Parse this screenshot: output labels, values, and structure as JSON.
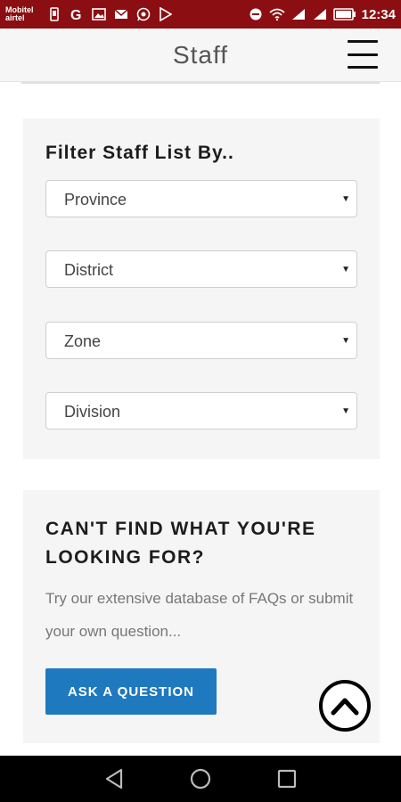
{
  "status_bar": {
    "carrier_1": "Mobitel",
    "carrier_2": "airtel",
    "time": "12:34",
    "battery_icon": "battery-icon",
    "wifi_icon": "wifi-icon",
    "signal_icon": "signal-icon",
    "background_color": "#8b0e12"
  },
  "header": {
    "title": "Staff",
    "menu_icon": "hamburger-menu-icon"
  },
  "filter": {
    "title": "Filter Staff List By..",
    "selects": [
      {
        "label": "Province"
      },
      {
        "label": "District"
      },
      {
        "label": "Zone"
      },
      {
        "label": "Division"
      }
    ]
  },
  "help": {
    "title": "CAN'T FIND WHAT YOU'RE LOOKING FOR?",
    "text": "Try our extensive database of FAQs or submit your own question...",
    "button_label": "ASK A QUESTION",
    "button_color": "#1f79bf"
  },
  "scroll_top_icon": "chevron-up-circle-icon",
  "nav_bar": {
    "back_icon": "back-triangle-icon",
    "home_icon": "home-circle-icon",
    "recents_icon": "recents-square-icon"
  }
}
